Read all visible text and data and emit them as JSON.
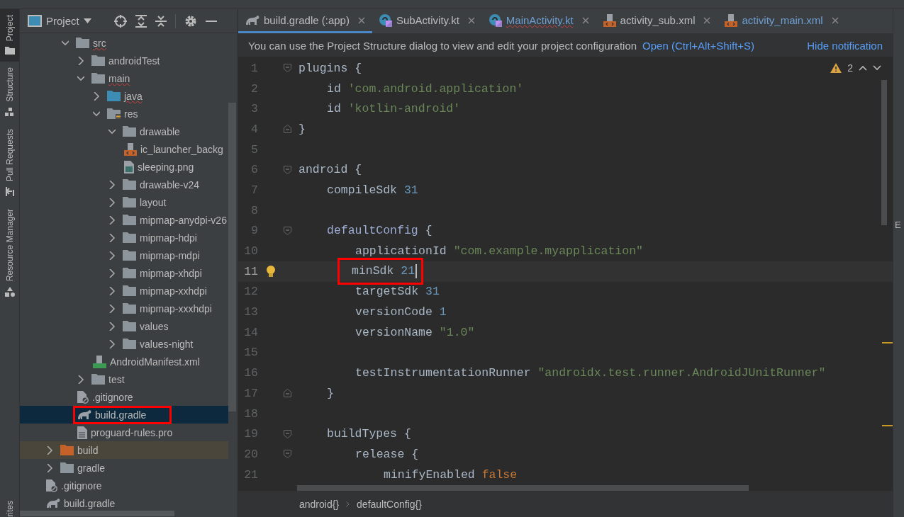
{
  "tool_strip": [
    {
      "label": "Project",
      "selected": true,
      "kind": "folder"
    },
    {
      "label": "Structure",
      "selected": false,
      "kind": "structure"
    },
    {
      "label": "Pull Requests",
      "selected": false,
      "kind": "pull"
    },
    {
      "label": "Resource Manager",
      "selected": false,
      "kind": "shapes"
    }
  ],
  "tool_strip_bottom": "rites",
  "project_panel": {
    "title": "Project",
    "tree": {
      "partial_branch": [
        {
          "label": "src",
          "kind": "folder",
          "expanded": true,
          "error": true,
          "selected": false,
          "excluded": false,
          "highlight_box": false,
          "children": [
            {
              "label": "androidTest",
              "kind": "folder",
              "expanded": false,
              "error": false,
              "selected": false,
              "excluded": false,
              "highlight_box": false
            },
            {
              "label": "main",
              "kind": "folder",
              "expanded": true,
              "error": true,
              "selected": false,
              "excluded": false,
              "highlight_box": false,
              "children": [
                {
                  "label": "java",
                  "kind": "folder-java",
                  "expanded": false,
                  "error": true,
                  "selected": false,
                  "excluded": false,
                  "highlight_box": false
                },
                {
                  "label": "res",
                  "kind": "folder-res",
                  "expanded": true,
                  "error": false,
                  "selected": false,
                  "excluded": false,
                  "highlight_box": false,
                  "children": [
                    {
                      "label": "drawable",
                      "kind": "folder",
                      "expanded": true,
                      "error": false,
                      "selected": false,
                      "excluded": false,
                      "highlight_box": false,
                      "children": [
                        {
                          "label": "ic_launcher_backg",
                          "kind": "xml",
                          "error": false,
                          "selected": false,
                          "excluded": false,
                          "highlight_box": false
                        },
                        {
                          "label": "sleeping.png",
                          "kind": "image",
                          "error": false,
                          "selected": false,
                          "excluded": false,
                          "highlight_box": false
                        }
                      ]
                    },
                    {
                      "label": "drawable-v24",
                      "kind": "folder",
                      "expanded": false,
                      "error": false,
                      "selected": false,
                      "excluded": false,
                      "highlight_box": false
                    },
                    {
                      "label": "layout",
                      "kind": "folder",
                      "expanded": false,
                      "error": false,
                      "selected": false,
                      "excluded": false,
                      "highlight_box": false
                    },
                    {
                      "label": "mipmap-anydpi-v26",
                      "kind": "folder",
                      "expanded": false,
                      "error": false,
                      "selected": false,
                      "excluded": false,
                      "highlight_box": false
                    },
                    {
                      "label": "mipmap-hdpi",
                      "kind": "folder",
                      "expanded": false,
                      "error": false,
                      "selected": false,
                      "excluded": false,
                      "highlight_box": false
                    },
                    {
                      "label": "mipmap-mdpi",
                      "kind": "folder",
                      "expanded": false,
                      "error": false,
                      "selected": false,
                      "excluded": false,
                      "highlight_box": false
                    },
                    {
                      "label": "mipmap-xhdpi",
                      "kind": "folder",
                      "expanded": false,
                      "error": false,
                      "selected": false,
                      "excluded": false,
                      "highlight_box": false
                    },
                    {
                      "label": "mipmap-xxhdpi",
                      "kind": "folder",
                      "expanded": false,
                      "error": false,
                      "selected": false,
                      "excluded": false,
                      "highlight_box": false
                    },
                    {
                      "label": "mipmap-xxxhdpi",
                      "kind": "folder",
                      "expanded": false,
                      "error": false,
                      "selected": false,
                      "excluded": false,
                      "highlight_box": false
                    },
                    {
                      "label": "values",
                      "kind": "folder",
                      "expanded": false,
                      "error": false,
                      "selected": false,
                      "excluded": false,
                      "highlight_box": false
                    },
                    {
                      "label": "values-night",
                      "kind": "folder",
                      "expanded": false,
                      "error": false,
                      "selected": false,
                      "excluded": false,
                      "highlight_box": false
                    }
                  ]
                },
                {
                  "label": "AndroidManifest.xml",
                  "kind": "manifest",
                  "error": false,
                  "selected": false,
                  "excluded": false,
                  "highlight_box": false
                }
              ]
            },
            {
              "label": "test",
              "kind": "folder",
              "expanded": false,
              "error": false,
              "selected": false,
              "excluded": false,
              "highlight_box": false
            },
            {
              "label": ".gitignore",
              "kind": "ignore",
              "error": false,
              "selected": false,
              "excluded": false,
              "highlight_box": false
            },
            {
              "label": "build.gradle",
              "kind": "gradle",
              "error": false,
              "selected": true,
              "excluded": false,
              "highlight_box": true
            },
            {
              "label": "proguard-rules.pro",
              "kind": "text",
              "error": false,
              "selected": false,
              "excluded": false,
              "highlight_box": false
            }
          ]
        }
      ],
      "items": [
        {
          "label": "build",
          "kind": "folder-build",
          "expanded": false,
          "error": false,
          "selected": false,
          "excluded": true,
          "highlight_box": false
        },
        {
          "label": "gradle",
          "kind": "folder",
          "expanded": false,
          "error": false,
          "selected": false,
          "excluded": false,
          "highlight_box": false
        },
        {
          "label": ".gitignore",
          "kind": "ignore",
          "error": false,
          "selected": false,
          "excluded": false,
          "highlight_box": false
        },
        {
          "label": "build.gradle",
          "kind": "gradle",
          "error": false,
          "selected": false,
          "excluded": false,
          "highlight_box": false
        }
      ]
    }
  },
  "editor_tabs": [
    {
      "label": "build.gradle (:app)",
      "kind": "gradle",
      "selected": true,
      "modified": false,
      "error": false
    },
    {
      "label": "SubActivity.kt",
      "kind": "kotlin",
      "selected": false,
      "modified": false,
      "error": false
    },
    {
      "label": "MainActivity.kt",
      "kind": "kotlin",
      "selected": false,
      "modified": true,
      "error": true
    },
    {
      "label": "activity_sub.xml",
      "kind": "xml",
      "selected": false,
      "modified": false,
      "error": false
    },
    {
      "label": "activity_main.xml",
      "kind": "xml",
      "selected": false,
      "modified": true,
      "error": false
    }
  ],
  "notification": {
    "text": "You can use the Project Structure dialog to view and edit your project configuration",
    "link": "Open (Ctrl+Alt+Shift+S)",
    "dismiss": "Hide notification"
  },
  "warnings": "2",
  "lines": [
    {
      "n": "1",
      "fold_start": true,
      "tokens": [
        {
          "kind": "plain",
          "text": "plugins {"
        }
      ],
      "children": [
        {
          "n": "2",
          "tokens": [
            {
              "kind": "plain",
              "text": "id "
            },
            {
              "kind": "string",
              "text": "'com.android.application'"
            }
          ]
        },
        {
          "n": "3",
          "tokens": [
            {
              "kind": "plain",
              "text": "id "
            },
            {
              "kind": "string",
              "text": "'kotlin-android'"
            }
          ]
        }
      ]
    },
    {
      "n": "4",
      "fold_end": true,
      "tokens": [
        {
          "kind": "plain",
          "text": "}"
        }
      ]
    },
    {
      "n": "5"
    },
    {
      "n": "6",
      "fold_start": true,
      "tokens": [
        {
          "kind": "plain",
          "text": "android {"
        }
      ],
      "children": [
        {
          "n": "7",
          "tokens": [
            {
              "kind": "plain",
              "text": "compileSdk "
            },
            {
              "kind": "number",
              "text": "31"
            }
          ]
        },
        {
          "n": "8"
        },
        {
          "n": "9",
          "fold_start": true,
          "tokens": [
            {
              "kind": "ident",
              "text": "defaultConfig"
            },
            {
              "kind": "plain",
              "text": " {"
            }
          ],
          "children": [
            {
              "n": "10",
              "tokens": [
                {
                  "kind": "plain",
                  "text": "applicationId "
                },
                {
                  "kind": "string",
                  "text": "\"com.example.myapplication\""
                }
              ]
            },
            {
              "n": "11",
              "current": true,
              "bulb": true,
              "cursor": true,
              "highlight_box": true,
              "tokens": [
                {
                  "kind": "plain",
                  "text": "minSdk "
                },
                {
                  "kind": "number",
                  "text": "21"
                }
              ]
            },
            {
              "n": "12",
              "tokens": [
                {
                  "kind": "plain",
                  "text": "targetSdk "
                },
                {
                  "kind": "number",
                  "text": "31"
                }
              ]
            },
            {
              "n": "13",
              "tokens": [
                {
                  "kind": "plain",
                  "text": "versionCode "
                },
                {
                  "kind": "number",
                  "text": "1"
                }
              ]
            },
            {
              "n": "14",
              "tokens": [
                {
                  "kind": "plain",
                  "text": "versionName "
                },
                {
                  "kind": "string",
                  "text": "\"1.0\""
                }
              ]
            },
            {
              "n": "15"
            },
            {
              "n": "16",
              "tokens": [
                {
                  "kind": "plain",
                  "text": "testInstrumentationRunner "
                },
                {
                  "kind": "string",
                  "text": "\"androidx.test.runner.AndroidJUnitRunner\""
                }
              ]
            }
          ]
        },
        {
          "n": "17",
          "fold_end": true,
          "tokens": [
            {
              "kind": "plain",
              "text": "}"
            }
          ]
        },
        {
          "n": "18"
        },
        {
          "n": "19",
          "fold_start": true,
          "tokens": [
            {
              "kind": "plain",
              "text": "buildTypes {"
            }
          ],
          "children": [
            {
              "n": "20",
              "fold_start": true,
              "tokens": [
                {
                  "kind": "plain",
                  "text": "release {"
                }
              ],
              "children": [
                {
                  "n": "21",
                  "tokens": [
                    {
                      "kind": "plain",
                      "text": "minifyEnabled "
                    },
                    {
                      "kind": "keyword",
                      "text": "false"
                    }
                  ]
                }
              ]
            }
          ]
        }
      ]
    }
  ],
  "breadcrumbs": [
    "android{}",
    "defaultConfig{}"
  ],
  "right_strip_label": "E"
}
